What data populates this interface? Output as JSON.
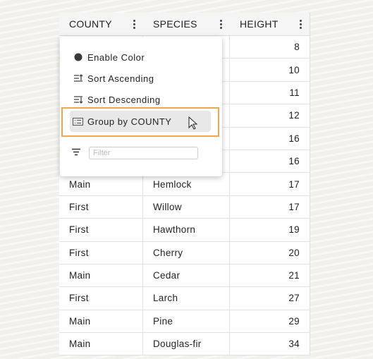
{
  "columns": [
    "COUNTY",
    "SPECIES",
    "HEIGHT"
  ],
  "rows": [
    {
      "county": "",
      "species": "",
      "height": "8"
    },
    {
      "county": "",
      "species": "",
      "height": "10"
    },
    {
      "county": "",
      "species": "",
      "height": "11"
    },
    {
      "county": "",
      "species": "",
      "height": "12"
    },
    {
      "county": "",
      "species": "",
      "height": "16"
    },
    {
      "county": "",
      "species": "",
      "height": "16"
    },
    {
      "county": "Main",
      "species": "Hemlock",
      "height": "17"
    },
    {
      "county": "First",
      "species": "Willow",
      "height": "17"
    },
    {
      "county": "First",
      "species": "Hawthorn",
      "height": "19"
    },
    {
      "county": "First",
      "species": "Cherry",
      "height": "20"
    },
    {
      "county": "Main",
      "species": "Cedar",
      "height": "21"
    },
    {
      "county": "First",
      "species": "Larch",
      "height": "27"
    },
    {
      "county": "Main",
      "species": "Pine",
      "height": "29"
    },
    {
      "county": "Main",
      "species": "Douglas-fir",
      "height": "34"
    }
  ],
  "menu": {
    "items": [
      {
        "label": "Enable Color",
        "icon": "circle-icon"
      },
      {
        "label": "Sort Ascending",
        "icon": "sort-ascending-icon"
      },
      {
        "label": "Sort Descending",
        "icon": "sort-descending-icon"
      },
      {
        "label": "Group by COUNTY",
        "icon": "group-list-icon",
        "active": true
      }
    ],
    "filter_placeholder": "Filter",
    "highlight_color": "#f5a550"
  }
}
